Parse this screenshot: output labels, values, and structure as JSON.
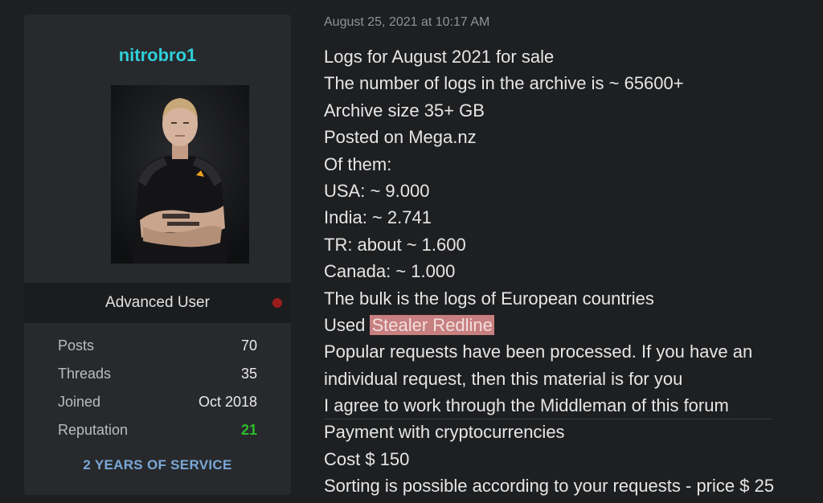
{
  "user": {
    "username": "nitrobro1",
    "role": "Advanced User",
    "stats": [
      {
        "label": "Posts",
        "value": "70"
      },
      {
        "label": "Threads",
        "value": "35"
      },
      {
        "label": "Joined",
        "value": "Oct 2018"
      },
      {
        "label": "Reputation",
        "value": "21"
      }
    ],
    "service": "2 YEARS OF SERVICE"
  },
  "post": {
    "date": "August 25, 2021 at 10:17 AM",
    "lines": [
      "Logs for August 2021 for sale",
      "The number of logs in the archive is ~ 65600+",
      "Archive size 35+ GB",
      "Posted on Mega.nz",
      "Of them:",
      "USA:  ~ 9.000",
      "India: ~ 2.741",
      "TR: about ~ 1.600",
      "Canada: ~ 1.000",
      "The bulk is the logs of European countries"
    ],
    "used_prefix": "Used ",
    "used_highlight": "Stealer Redline",
    "lines_after": [
      "Popular requests have been processed. If you have an",
      "individual request, then this material is for you",
      "I agree to work through the Middleman of this forum",
      "Payment with cryptocurrencies",
      "Cost $ 150",
      "Sorting is possible according to your requests - price $ 25"
    ]
  },
  "colors": {
    "username": "#2fcfd9",
    "reputation": "#2dbb2d",
    "service": "#7aa7d6",
    "status_dot": "#9b1c1c",
    "highlight": "#c77f80"
  }
}
